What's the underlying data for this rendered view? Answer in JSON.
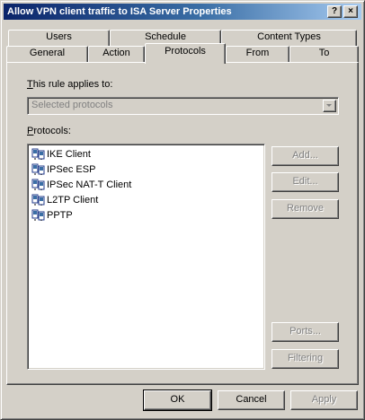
{
  "window": {
    "title": "Allow VPN client traffic to ISA Server Properties",
    "help_button": "?",
    "close_button": "×"
  },
  "tabs_back": [
    {
      "label": "Users"
    },
    {
      "label": "Schedule"
    },
    {
      "label": "Content Types"
    }
  ],
  "tabs_front": [
    {
      "label": "General"
    },
    {
      "label": "Action"
    },
    {
      "label": "Protocols",
      "selected": true
    },
    {
      "label": "From"
    },
    {
      "label": "To"
    }
  ],
  "applies": {
    "label_first": "T",
    "label_rest": "his rule applies to:",
    "selected": "Selected protocols"
  },
  "protocols": {
    "label_first": "P",
    "label_rest": "rotocols:",
    "items": [
      {
        "label": "IKE Client",
        "icon": "protocol-icon"
      },
      {
        "label": "IPSec ESP",
        "icon": "protocol-icon"
      },
      {
        "label": "IPSec NAT-T Client",
        "icon": "protocol-icon"
      },
      {
        "label": "L2TP Client",
        "icon": "protocol-icon"
      },
      {
        "label": "PPTP",
        "icon": "protocol-icon"
      }
    ]
  },
  "side_buttons": {
    "add": "Add...",
    "edit": "Edit...",
    "remove": "Remove",
    "ports": "Ports...",
    "filtering": "Filtering"
  },
  "footer": {
    "ok": "OK",
    "cancel": "Cancel",
    "apply": "Apply"
  },
  "colors": {
    "face": "#d4d0c8",
    "title_active": "#0a246a",
    "disabled_text": "#808080"
  }
}
